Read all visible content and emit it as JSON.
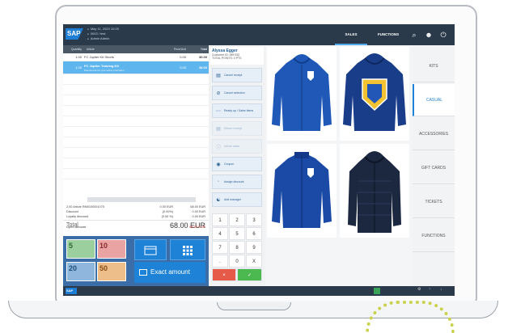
{
  "header": {
    "logo": "SAP",
    "info": [
      "May 11, 2023 10:25",
      "0003 / test",
      "Admin Admin"
    ],
    "tabs": [
      {
        "label": "SALES",
        "active": true
      },
      {
        "label": "FUNCTIONS",
        "active": false
      }
    ],
    "icons": [
      "search-icon",
      "user-icon",
      "power-icon"
    ]
  },
  "cart": {
    "columns": [
      "Quantity",
      "Article",
      "Price/Unit",
      "Total"
    ],
    "rows": [
      {
        "qty": "1.00",
        "item": "FC Jupiter Kit Shorts",
        "sub": "",
        "price": "0.00",
        "total": "30.00",
        "selected": false
      },
      {
        "qty": "1.00",
        "item": "FC Jupiter Training Kit",
        "sub": "Discount as for your active promotion",
        "price": "0.00",
        "total": "38.00",
        "selected": true
      }
    ]
  },
  "totals": {
    "lines": [
      {
        "l": "2.00 Article  RM0100001075",
        "m": "0.00 EUR",
        "r": "68.00 EUR"
      },
      {
        "l": "Discount",
        "m": "(0.00%)",
        "r": "0.00 EUR"
      },
      {
        "l": "Loyalty discount",
        "m": "(0.00 %)",
        "r": "0.00 EUR"
      }
    ],
    "total_label": "Total",
    "total_value": "68.00 EUR",
    "open_label": "Open amount",
    "open_value": "68.00 EUR"
  },
  "payment": {
    "bills": [
      "5",
      "10",
      "20",
      "50"
    ],
    "exact_label": "Exact amount"
  },
  "customer": {
    "name": "Alyssa Egger",
    "line1": "Customer ID: 085 532",
    "line2": "TOTAL POINTS: 0 PTS"
  },
  "actions": [
    {
      "label": "Cancel receipt",
      "icon": "receipt-icon",
      "enabled": true
    },
    {
      "label": "Cancel selection",
      "icon": "cancel-icon",
      "enabled": true
    },
    {
      "label": "Ready up / Sales Items",
      "icon": "list-icon",
      "enabled": true
    },
    {
      "label": "Return receipt",
      "icon": "return-icon",
      "enabled": false
    },
    {
      "label": "Inform sales",
      "icon": "info-icon",
      "enabled": false
    },
    {
      "label": "Coupon",
      "icon": "coupon-icon",
      "enabled": true
    },
    {
      "label": "Assign discount",
      "icon": "discount-icon",
      "enabled": true
    },
    {
      "label": "Add manager",
      "icon": "manager-icon",
      "enabled": true
    }
  ],
  "keypad": [
    "1",
    "2",
    "3",
    "4",
    "5",
    "6",
    "7",
    "8",
    "9",
    ".",
    "0",
    "X"
  ],
  "keypad_actions": {
    "cancel": "×",
    "confirm": "✓"
  },
  "categories": [
    {
      "label": "KITS",
      "active": false
    },
    {
      "label": "CASUAL",
      "active": true
    },
    {
      "label": "ACCESSORIES",
      "active": false
    },
    {
      "label": "GIFT CARDS",
      "active": false
    },
    {
      "label": "TICKETS",
      "active": false
    },
    {
      "label": "FUNCTIONS",
      "active": false
    }
  ],
  "products": [
    {
      "name": "blue-zip-hoodie",
      "color": "#1f58b6"
    },
    {
      "name": "navy-crest-hoodie",
      "color": "#1a3d8a"
    },
    {
      "name": "blue-track-jacket",
      "color": "#1a4aa6"
    },
    {
      "name": "dark-winter-coat",
      "color": "#1c2740"
    }
  ],
  "footer": {
    "logo": "SAP"
  }
}
